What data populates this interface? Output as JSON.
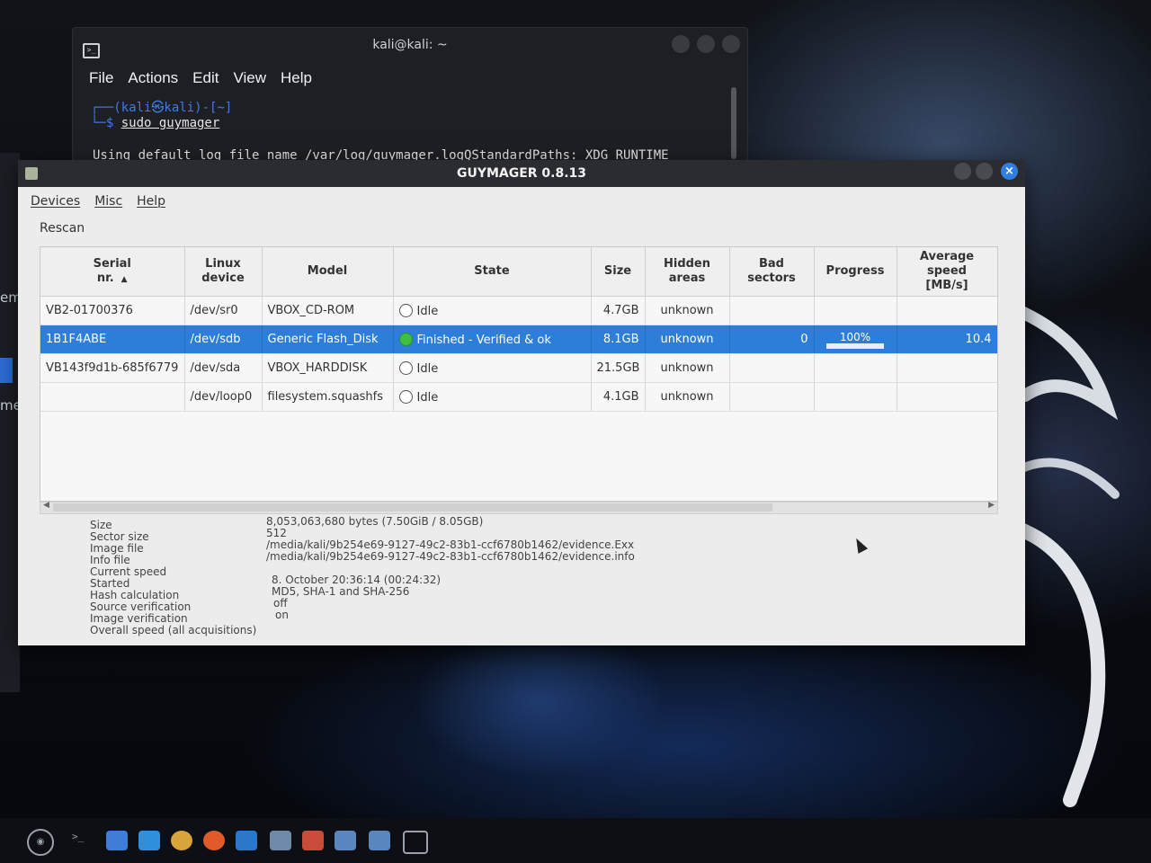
{
  "terminal": {
    "title": "kali@kali: ~",
    "menu": [
      "File",
      "Actions",
      "Edit",
      "View",
      "Help"
    ],
    "prompt": "┌──(kali㉿kali)-[~]",
    "command_prefix": "└─$ ",
    "command": "sudo guymager",
    "output": "Using default log file name /var/log/guymager.logQStandardPaths: XDG_RUNTIME_"
  },
  "guymager": {
    "title": "GUYMAGER 0.8.13",
    "menu": [
      "Devices",
      "Misc",
      "Help"
    ],
    "toolbar": {
      "rescan": "Rescan"
    },
    "columns": [
      "Serial\nnr.",
      "Linux\ndevice",
      "Model",
      "State",
      "Size",
      "Hidden\nareas",
      "Bad\nsectors",
      "Progress",
      "Average\nspeed\n[MB/s]"
    ],
    "rows": [
      {
        "serial": "VB2-01700376",
        "device": "/dev/sr0",
        "model": "VBOX_CD-ROM",
        "state": "Idle",
        "state_icon": "idle-circle",
        "size": "4.7GB",
        "hidden": "unknown",
        "bad": "",
        "progress": "",
        "speed": ""
      },
      {
        "serial": "1B1F4ABE",
        "device": "/dev/sdb",
        "model": "Generic Flash_Disk",
        "state": "Finished - Verified & ok",
        "state_icon": "finished-green-circle",
        "size": "8.1GB",
        "hidden": "unknown",
        "bad": "0",
        "progress": "100%",
        "progress_value": 1.0,
        "speed": "10.4"
      },
      {
        "serial": "VB143f9d1b-685f6779",
        "device": "/dev/sda",
        "model": "VBOX_HARDDISK",
        "state": "Idle",
        "state_icon": "idle-circle",
        "size": "21.5GB",
        "hidden": "unknown",
        "bad": "",
        "progress": "",
        "speed": ""
      },
      {
        "serial": "",
        "device": "/dev/loop0",
        "model": "filesystem.squashfs",
        "state": "Idle",
        "state_icon": "idle-circle",
        "size": "4.1GB",
        "hidden": "unknown",
        "bad": "",
        "progress": "",
        "speed": ""
      }
    ],
    "details": {
      "labels": [
        "Size",
        "Sector size",
        "Image file",
        "Info file",
        "Current speed",
        "Started",
        "Hash calculation",
        "Source verification",
        "Image verification",
        "Overall speed (all acquisitions)"
      ],
      "values": [
        "8,053,063,680 bytes (7.50GiB / 8.05GB)",
        "512",
        "/media/kali/9b254e69-9127-49c2-83b1-ccf6780b1462/evidence.Exx",
        "/media/kali/9b254e69-9127-49c2-83b1-ccf6780b1462/evidence.info",
        "",
        "8. October 20:36:14 (00:24:32)",
        "MD5, SHA-1 and SHA-256",
        "off",
        "on",
        ""
      ]
    }
  },
  "desktop": {
    "left_edge_labels": [
      "em",
      "me"
    ],
    "accent": "#2c7ed8"
  },
  "taskbar": {
    "icons": [
      "menu-icon",
      "terminal-icon",
      "files-icon",
      "telegram-icon",
      "chrome-icon",
      "burp-icon",
      "vscode-icon",
      "camera-icon",
      "color-icon",
      "monitor-icon",
      "monitor2-icon",
      "code-icon"
    ]
  }
}
